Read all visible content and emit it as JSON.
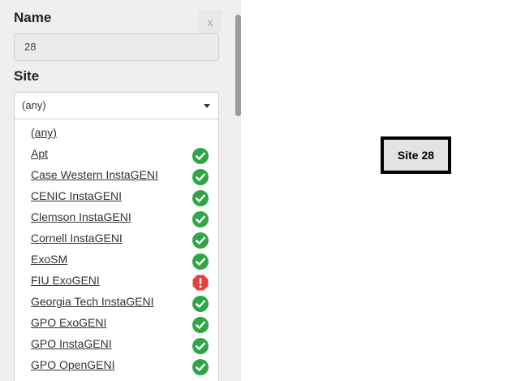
{
  "form": {
    "name_label": "Name",
    "name_value": "28",
    "site_label": "Site",
    "site_selected": "(any)",
    "close_label": "x"
  },
  "site_options": [
    {
      "label": "(any)",
      "status": "none"
    },
    {
      "label": "Apt",
      "status": "ok"
    },
    {
      "label": "Case Western InstaGENI",
      "status": "ok"
    },
    {
      "label": "CENIC InstaGENI",
      "status": "ok"
    },
    {
      "label": "Clemson InstaGENI",
      "status": "ok"
    },
    {
      "label": "Cornell InstaGENI",
      "status": "ok"
    },
    {
      "label": "ExoSM",
      "status": "ok"
    },
    {
      "label": "FIU ExoGENI",
      "status": "error"
    },
    {
      "label": "Georgia Tech InstaGENI",
      "status": "ok"
    },
    {
      "label": "GPO ExoGENI",
      "status": "ok"
    },
    {
      "label": "GPO InstaGENI",
      "status": "ok"
    },
    {
      "label": "GPO OpenGENI",
      "status": "ok"
    }
  ],
  "canvas": {
    "node_label": "Site 28"
  },
  "colors": {
    "ok": "#2fa646",
    "error": "#e8413b"
  }
}
